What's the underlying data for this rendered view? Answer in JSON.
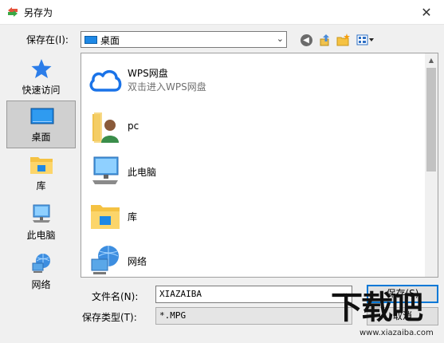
{
  "window": {
    "title": "另存为",
    "close_glyph": "✕"
  },
  "location": {
    "label": "保存在(I):",
    "value": "桌面"
  },
  "toolbar": {
    "back": "back-icon",
    "up": "up-folder-icon",
    "new_folder": "new-folder-icon",
    "view": "view-menu-icon"
  },
  "places": [
    {
      "label": "快速访问",
      "icon": "star-icon"
    },
    {
      "label": "桌面",
      "icon": "desktop-icon"
    },
    {
      "label": "库",
      "icon": "library-icon"
    },
    {
      "label": "此电脑",
      "icon": "computer-icon"
    },
    {
      "label": "网络",
      "icon": "network-icon"
    }
  ],
  "files": [
    {
      "name": "WPS网盘",
      "subtitle": "双击进入WPS网盘",
      "icon": "cloud-icon"
    },
    {
      "name": "pc",
      "icon": "user-folder-icon"
    },
    {
      "name": "此电脑",
      "icon": "computer-icon"
    },
    {
      "name": "库",
      "icon": "library-icon"
    },
    {
      "name": "网络",
      "icon": "network-icon"
    }
  ],
  "form": {
    "filename_label": "文件名(N):",
    "filename_value": "XIAZAIBA",
    "filetype_label": "保存类型(T):",
    "filetype_value": "*.MPG",
    "save_label": "保存(S)",
    "cancel_label": "取消"
  },
  "watermark": {
    "text": "下载吧",
    "sub": "www.xiazaiba.com"
  },
  "colors": {
    "accent": "#0078d7",
    "folder": "#f5c242",
    "cloud": "#1a73e8"
  }
}
